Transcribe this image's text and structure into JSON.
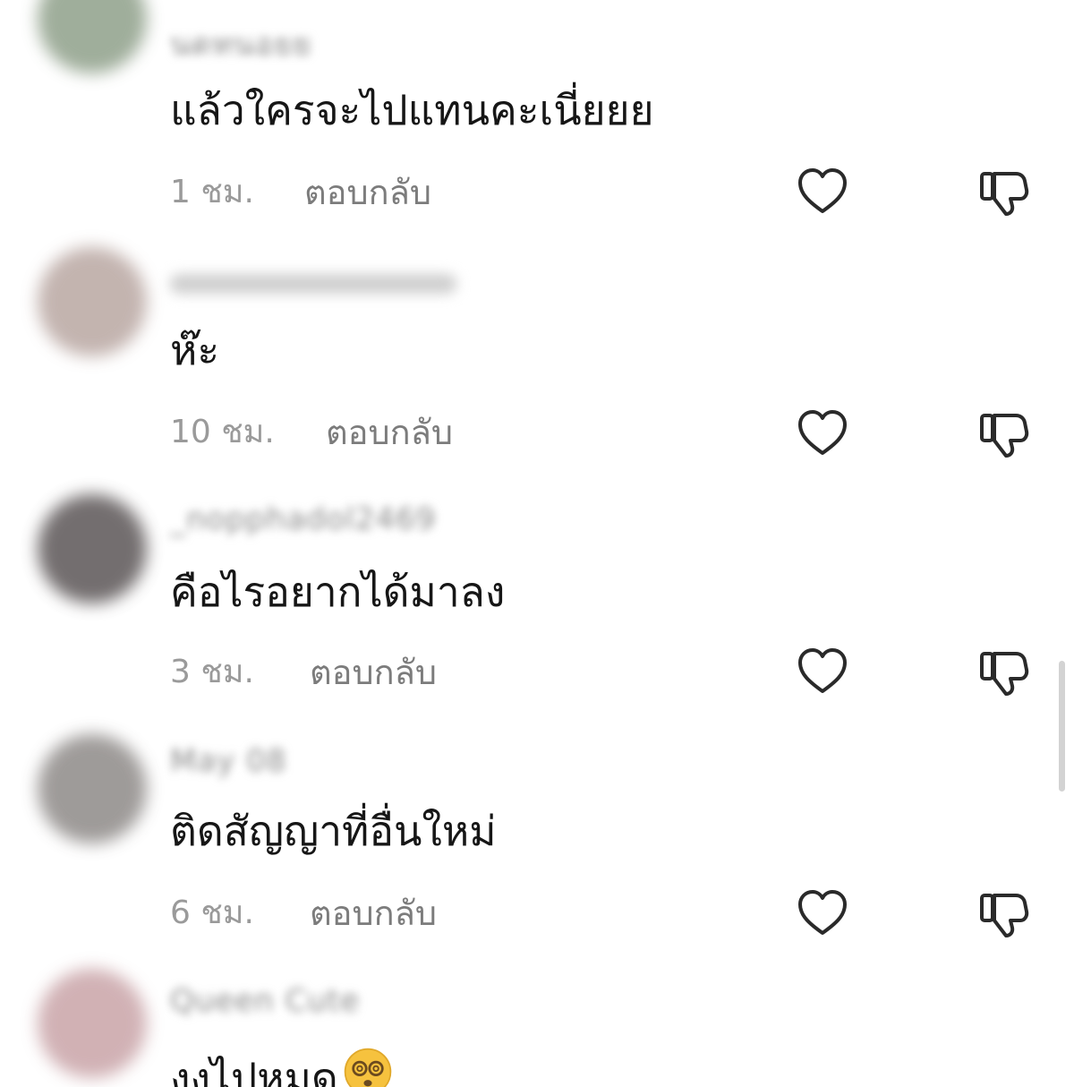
{
  "comments": [
    {
      "username": "นดทนอยย",
      "text": "แล้วใครจะไปแทนคะเนี่ยยย",
      "time": "1 ชม.",
      "reply_label": "ตอบกลับ",
      "avatar_color": "#8fa08a"
    },
    {
      "username": "",
      "text": "ห๊ะ",
      "time": "10 ชม.",
      "reply_label": "ตอบกลับ",
      "avatar_color": "#b9a7a2"
    },
    {
      "username": "_nopphadol2469",
      "text": "คือไรอยากได้มาลง",
      "time": "3 ชม.",
      "reply_label": "ตอบกลับ",
      "avatar_color": "#5b5556"
    },
    {
      "username": "May 08",
      "text": "ติดสัญญาที่อื่นใหม่",
      "time": "6 ชม.",
      "reply_label": "ตอบกลับ",
      "avatar_color": "#8e8a88"
    },
    {
      "username": "Queen Cute",
      "text": "งงไปหมด",
      "time": "",
      "reply_label": "",
      "avatar_color": "#c9a4a8"
    }
  ],
  "icons": {
    "like": "heart-outline-icon",
    "dislike": "thumbs-down-outline-icon",
    "emoji": "dizzy-face-emoji"
  }
}
